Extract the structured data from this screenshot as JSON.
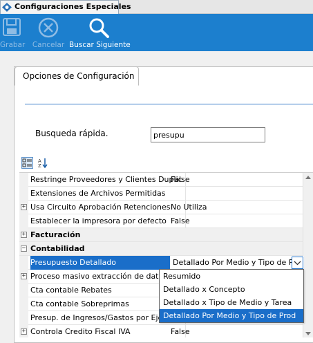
{
  "window_tab": {
    "title": "Configuraciones Especiales"
  },
  "toolbar": {
    "save_label": "Grabar",
    "cancel_label": "Cancelar",
    "find_next_label": "Buscar Siguiente"
  },
  "config_tab": {
    "label": "Opciones de Configuración"
  },
  "search": {
    "label": "Busqueda rápida.",
    "value": "presupu"
  },
  "grid": {
    "rows": [
      {
        "name": "Restringe Proveedores y Clientes Duplic",
        "value": "False"
      },
      {
        "name": "Extensiones de Archivos Permitidas",
        "value": ""
      },
      {
        "name": "Usa Circuito Aprobación Retenciones",
        "value": "No Utiliza"
      },
      {
        "name": "Establecer la impresora por defecto",
        "value": "False"
      },
      {
        "name": "Facturación",
        "value": ""
      },
      {
        "name": "Contabilidad",
        "value": ""
      },
      {
        "name": "Presupuesto Detallado",
        "value": "Detallado Por Medio y Tipo de Prod"
      },
      {
        "name": "Proceso masivo extracción de datos",
        "value": ""
      },
      {
        "name": "Cta contable Rebates",
        "value": ""
      },
      {
        "name": "Cta contable Sobreprimas",
        "value": ""
      },
      {
        "name": "Presup. de Ingresos/Gastos por Ejerci",
        "value": ""
      },
      {
        "name": "Controla Credito Fiscal IVA",
        "value": "False"
      }
    ]
  },
  "dropdown": {
    "options": [
      "Resumido",
      "Detallado x Concepto",
      "Detallado x Tipo de Medio y Tarea",
      "Detallado Por Medio y Tipo de Prod"
    ]
  },
  "colors": {
    "toolbar_bg": "#1c7fce",
    "selection": "#1a6ec9"
  }
}
